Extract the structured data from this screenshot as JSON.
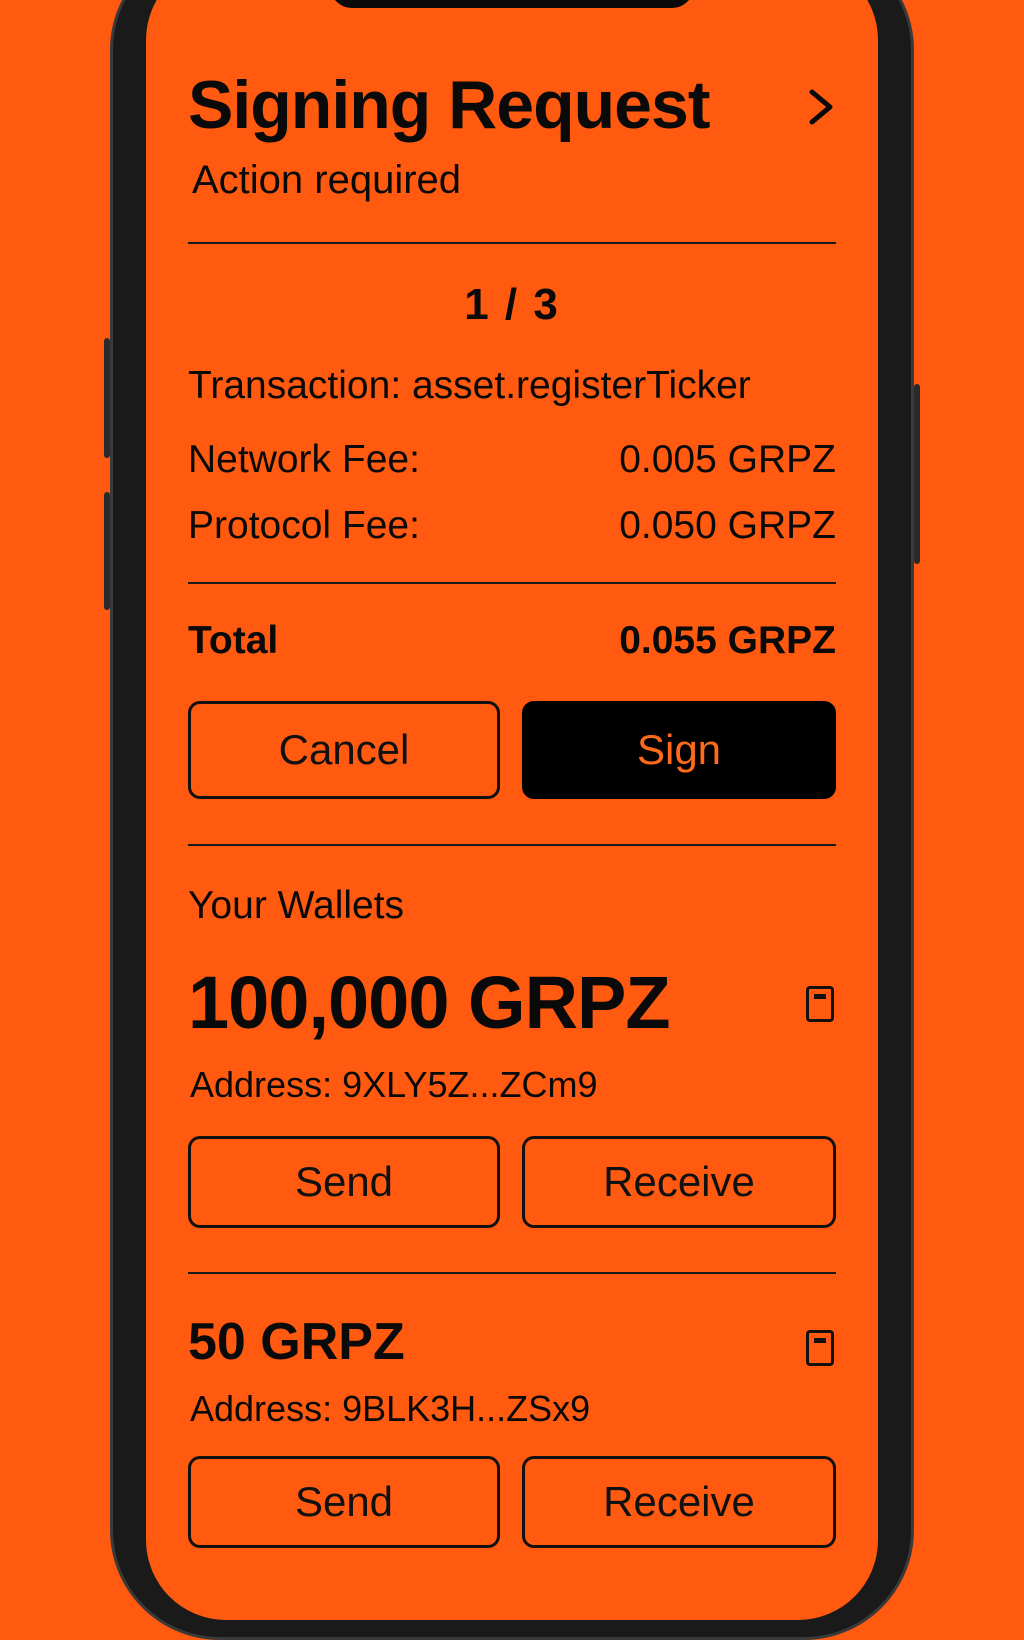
{
  "header": {
    "title": "Signing Request",
    "subtitle": "Action required"
  },
  "request": {
    "counter": "1 / 3",
    "transaction": "Transaction: asset.registerTicker",
    "network_fee_label": "Network Fee:",
    "network_fee_value": "0.005 GRPZ",
    "protocol_fee_label": "Protocol Fee:",
    "protocol_fee_value": "0.050 GRPZ",
    "total_label": "Total",
    "total_value": "0.055 GRPZ",
    "cancel_label": "Cancel",
    "sign_label": "Sign"
  },
  "wallets": {
    "section_label": "Your Wallets",
    "items": [
      {
        "balance": "100,000 GRPZ",
        "address": "Address: 9XLY5Z...ZCm9",
        "send_label": "Send",
        "receive_label": "Receive"
      },
      {
        "balance": "50 GRPZ",
        "address": "Address: 9BLK3H...ZSx9",
        "send_label": "Send",
        "receive_label": "Receive"
      }
    ]
  },
  "icons": {
    "chevron": "chevron-right-icon",
    "copy": "copy-icon"
  },
  "colors": {
    "background": "#ff5a10",
    "primary_button": "#000000",
    "primary_button_text": "#ff6a1a",
    "text": "#0a0a0a"
  }
}
